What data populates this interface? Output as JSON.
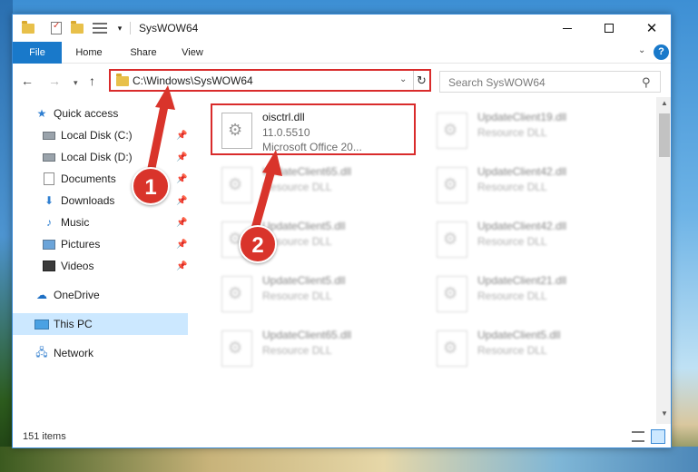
{
  "window": {
    "title": "SysWOW64"
  },
  "ribbon": {
    "tabs": [
      "File",
      "Home",
      "Share",
      "View"
    ],
    "help_label": "?"
  },
  "navigation": {
    "address": "C:\\Windows\\SysWOW64",
    "search_placeholder": "Search SysWOW64"
  },
  "sidebar": {
    "items": [
      {
        "label": "Quick access",
        "icon": "quick-access-star-icon",
        "pinned": false
      },
      {
        "label": "Local Disk (C:)",
        "icon": "local-disk-icon",
        "pinned": true
      },
      {
        "label": "Local Disk (D:)",
        "icon": "local-disk-icon",
        "pinned": true
      },
      {
        "label": "Documents",
        "icon": "documents-icon",
        "pinned": true
      },
      {
        "label": "Downloads",
        "icon": "downloads-icon",
        "pinned": true
      },
      {
        "label": "Music",
        "icon": "music-icon",
        "pinned": true
      },
      {
        "label": "Pictures",
        "icon": "pictures-icon",
        "pinned": true
      },
      {
        "label": "Videos",
        "icon": "videos-icon",
        "pinned": true
      },
      {
        "label": "OneDrive",
        "icon": "onedrive-cloud-icon",
        "pinned": false
      },
      {
        "label": "This PC",
        "icon": "this-pc-icon",
        "pinned": false,
        "selected": true
      },
      {
        "label": "Network",
        "icon": "network-icon",
        "pinned": false
      }
    ]
  },
  "files": [
    {
      "name": "oisctrl.dll",
      "line2": "11.0.5510",
      "line3": "Microsoft Office 20...",
      "highlighted": true
    },
    {
      "name": "UpdateClient19.dll",
      "line2": "Resource DLL",
      "blurred": true
    },
    {
      "name": "UpdateClient65.dll",
      "line2": "Resource DLL",
      "blurred": true
    },
    {
      "name": "UpdateClient42.dll",
      "line2": "Resource DLL",
      "blurred": true
    },
    {
      "name": "UpdateClient5.dll",
      "line2": "Resource DLL",
      "blurred": true
    },
    {
      "name": "UpdateClient42.dll",
      "line2": "Resource DLL",
      "blurred": true
    },
    {
      "name": "UpdateClient5.dll",
      "line2": "Resource DLL",
      "blurred": true
    },
    {
      "name": "UpdateClient21.dll",
      "line2": "Resource DLL",
      "blurred": true
    },
    {
      "name": "UpdateClient65.dll",
      "line2": "Resource DLL",
      "blurred": true
    },
    {
      "name": "UpdateClient5.dll",
      "line2": "Resource DLL",
      "blurred": true
    }
  ],
  "status": {
    "item_count": "151 items"
  },
  "annotations": {
    "step1": "1",
    "step2": "2",
    "accent_color": "#d9342b"
  }
}
